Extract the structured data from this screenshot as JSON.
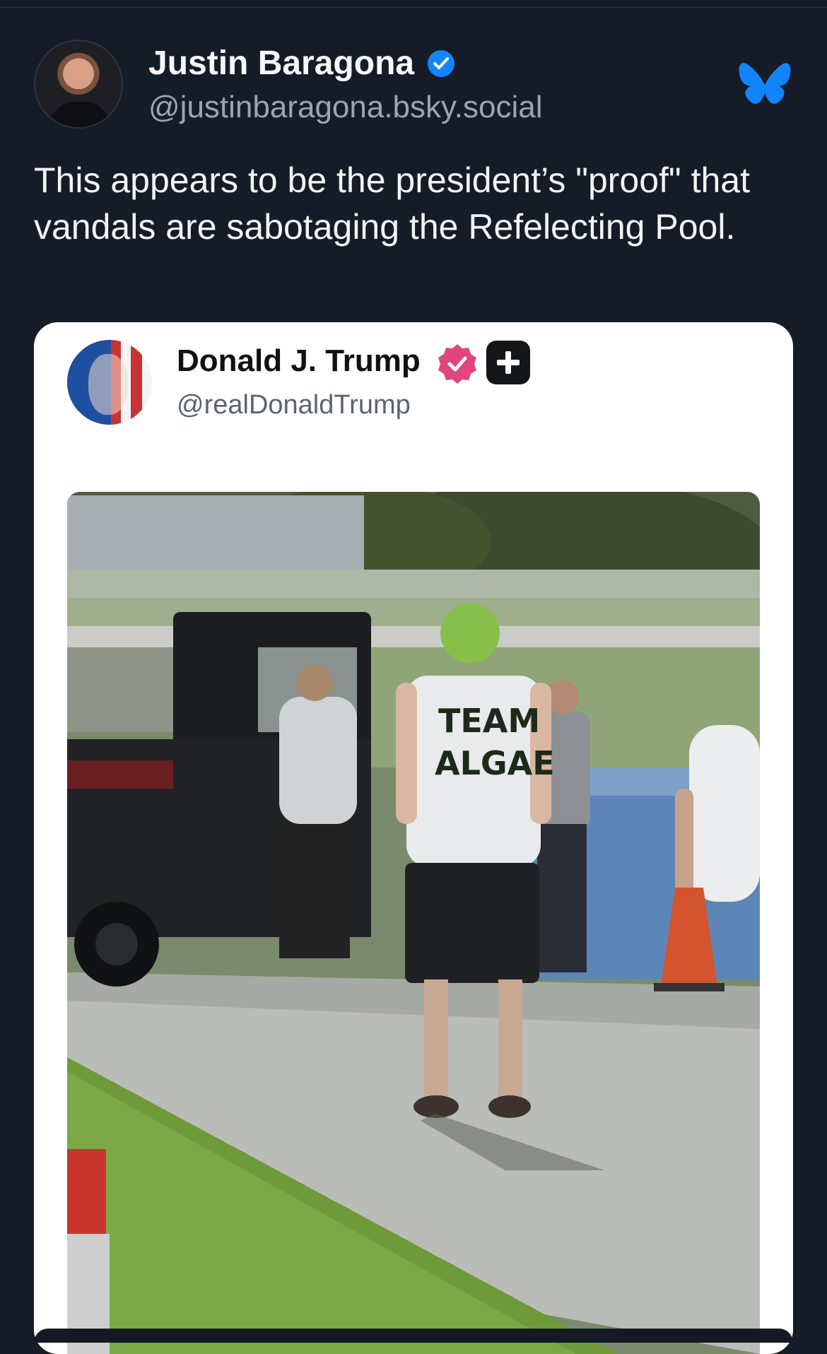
{
  "post": {
    "author": {
      "display_name": "Justin Baragona",
      "handle": "@justinbaragona.bsky.social",
      "verified": true
    },
    "text": "This appears to be the president’s \"proof\" that vandals are sabotaging the Refelecting Pool.",
    "platform_icon": "butterfly-icon"
  },
  "embedded": {
    "author": {
      "display_name": "Donald J. Trump",
      "handle": "@realDonaldTrump"
    },
    "badges": [
      "verified-badge-icon",
      "plus-icon"
    ],
    "photo": {
      "shirt_text": "TEAM ALGAE"
    }
  },
  "colors": {
    "background": "#161c27",
    "text": "#f1f3f5",
    "muted": "#9aa5b4",
    "accent_blue": "#1185fe",
    "badge_pink": "#e0457b"
  }
}
